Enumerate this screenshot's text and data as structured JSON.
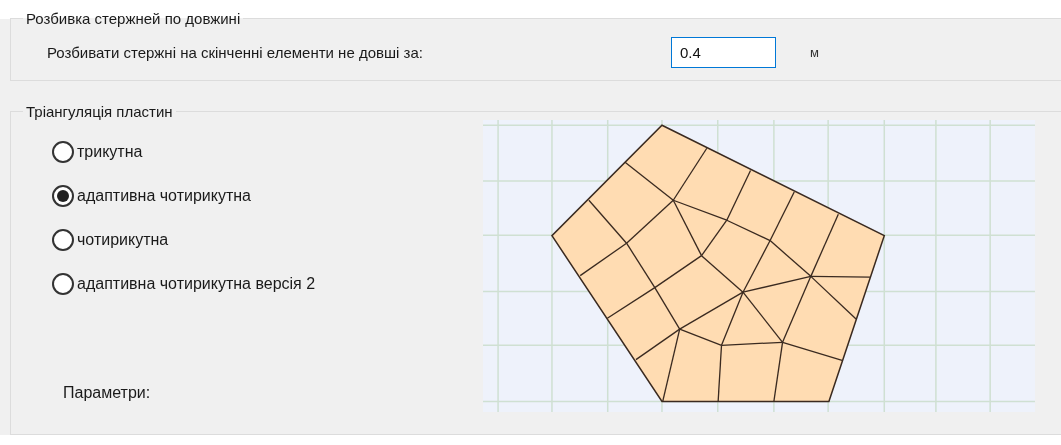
{
  "bar_division": {
    "title": "Розбивка стержней по довжині",
    "label": "Розбивати стержні на скінченні елементи не довші за:",
    "value": "0.4",
    "unit": "м"
  },
  "triangulation": {
    "title": "Тріангуляція пластин",
    "options": [
      {
        "label": "трикутна",
        "selected": false
      },
      {
        "label": "адаптивна чотирикутна",
        "selected": true
      },
      {
        "label": "чотирикутна",
        "selected": false
      },
      {
        "label": "адаптивна чотирикутна версія 2",
        "selected": false
      }
    ],
    "parameters_label": "Параметри:"
  }
}
